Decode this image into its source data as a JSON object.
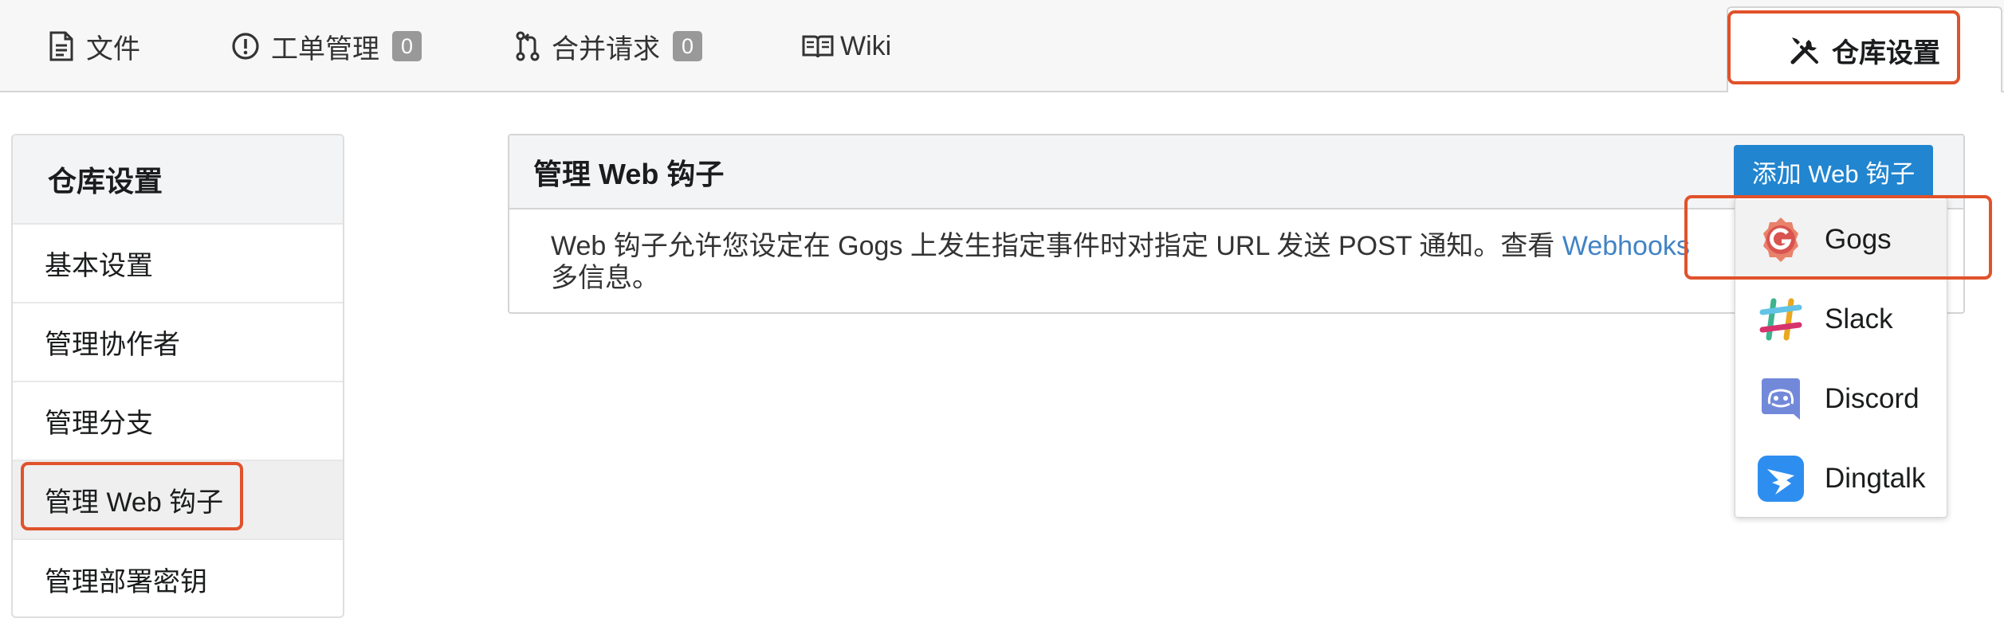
{
  "tabs": [
    {
      "label": "文件",
      "icon": "file-text-icon"
    },
    {
      "label": "工单管理",
      "icon": "issue-opened-icon",
      "count": "0"
    },
    {
      "label": "合并请求",
      "icon": "git-pull-request-icon",
      "count": "0"
    },
    {
      "label": "Wiki",
      "icon": "book-icon"
    }
  ],
  "settings_tab": {
    "label": "仓库设置",
    "icon": "tools-icon"
  },
  "sidebar": {
    "header": "仓库设置",
    "items": [
      {
        "label": "基本设置"
      },
      {
        "label": "管理协作者"
      },
      {
        "label": "管理分支"
      },
      {
        "label": "管理 Web 钩子"
      },
      {
        "label": "管理部署密钥"
      }
    ]
  },
  "panel": {
    "title": "管理 Web 钩子",
    "description_pre": "Web 钩子允许您设定在 Gogs 上发生指定事件时对指定 URL 发送 POST 通知。查看 ",
    "description_link": "Webhooks",
    "description_post": "多信息。"
  },
  "add_button": {
    "label": "添加 Web 钩子"
  },
  "dropdown": {
    "items": [
      {
        "label": "Gogs",
        "icon": "gogs-logo-icon"
      },
      {
        "label": "Slack",
        "icon": "slack-logo-icon"
      },
      {
        "label": "Discord",
        "icon": "discord-logo-icon"
      },
      {
        "label": "Dingtalk",
        "icon": "dingtalk-logo-icon"
      }
    ]
  },
  "colors": {
    "accent": "#2185d0",
    "highlight": "#e0522b",
    "link": "#4183c4",
    "badge": "#999999"
  }
}
